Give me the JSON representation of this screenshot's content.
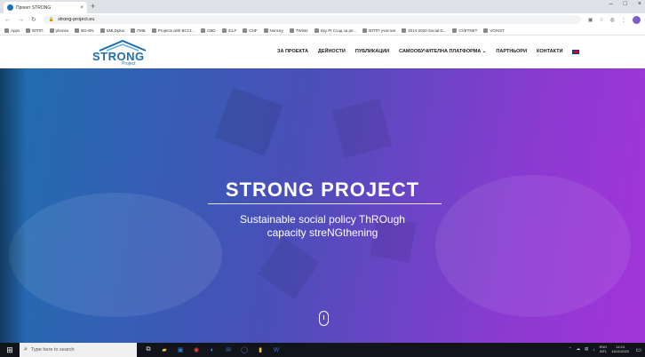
{
  "browser": {
    "tab_title": "Проект STRONG",
    "tab_close": "×",
    "new_tab": "+",
    "window_controls": [
      "–",
      "□",
      "×"
    ],
    "url": "strong-project.eu",
    "nav_icons": [
      "arrow-left-icon",
      "arrow-right-icon",
      "reload-icon"
    ],
    "bookmarks": [
      "Apps",
      "BTПП",
      "phones",
      "BG-EN",
      "SMLDplus",
      "ПИБ",
      "Projects with BCCI...",
      "CBD",
      "ICLF",
      "CNF",
      "Noncey",
      "TWists",
      "Sky-Ft Създ за ре...",
      "BTПП участия",
      "2014-2020 Social D...",
      "CVETNET",
      "VOXIST"
    ]
  },
  "site": {
    "logo_text": "STRONG",
    "logo_sub": "Project",
    "menu": [
      "ЗА ПРОЕКТА",
      "ДЕЙНОСТИ",
      "ПУБЛИКАЦИИ",
      "САМООБУЧИТЕЛНА ПЛАТФОРМА ⌄",
      "ПАРТНЬОРИ",
      "КОНТАКТИ"
    ],
    "accent": "#1d6fb0",
    "gradient_colors": [
      "#1e6fb0",
      "#a235d8"
    ]
  },
  "hero": {
    "title": "STRONG PROJECT",
    "subtitle_line1": "Sustainable social policy ThROugh",
    "subtitle_line2": "capacity streNGthening"
  },
  "taskbar": {
    "search_placeholder": "Type here to search",
    "lang_top": "ENG",
    "lang_bottom": "INTL",
    "time": "14:24",
    "date": "16/11/2020"
  }
}
